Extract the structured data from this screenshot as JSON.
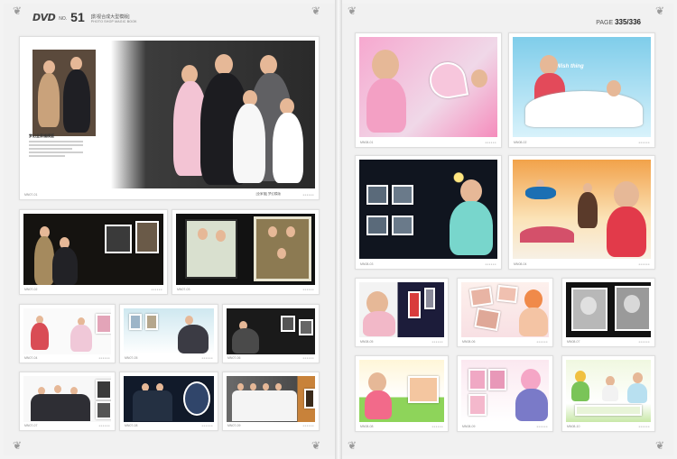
{
  "header": {
    "logo_dvd": "DVD",
    "logo_no": "NO.",
    "logo_num": "51",
    "logo_cn": "[影视合成大型模版]",
    "logo_en": "PHOTO SHOP MAGIC BOOK",
    "page_prefix": "PAGE",
    "page_numbers": "335/336"
  },
  "left_page": {
    "feature": {
      "code": "MN07-01",
      "signature": "[全家福] 梦幻模版",
      "caption_title": "梦幻全家福模版"
    },
    "tiles": [
      {
        "code": "MN07-02"
      },
      {
        "code": "MN07-03"
      },
      {
        "code": "MN07-04"
      },
      {
        "code": "MN07-05"
      },
      {
        "code": "MN07-06"
      },
      {
        "code": "MN07-07"
      },
      {
        "code": "MN07-08"
      },
      {
        "code": "MN07-09"
      }
    ]
  },
  "right_page": {
    "tiles": [
      {
        "code": "MN08-01"
      },
      {
        "code": "MN08-02",
        "overlay_text": "Wish thing"
      },
      {
        "code": "MN08-03"
      },
      {
        "code": "MN08-04"
      },
      {
        "code": "MN08-05"
      },
      {
        "code": "MN08-06"
      },
      {
        "code": "MN08-07"
      },
      {
        "code": "MN08-08"
      },
      {
        "code": "MN08-09"
      },
      {
        "code": "MN08-10"
      }
    ]
  },
  "dots": "●●●●●●",
  "colors": {
    "page_bg": "#f1f1f1",
    "tile_bg": "#ffffff",
    "pink": "#f08cc0",
    "sky": "#6ec3e8",
    "dark": "#141414"
  }
}
